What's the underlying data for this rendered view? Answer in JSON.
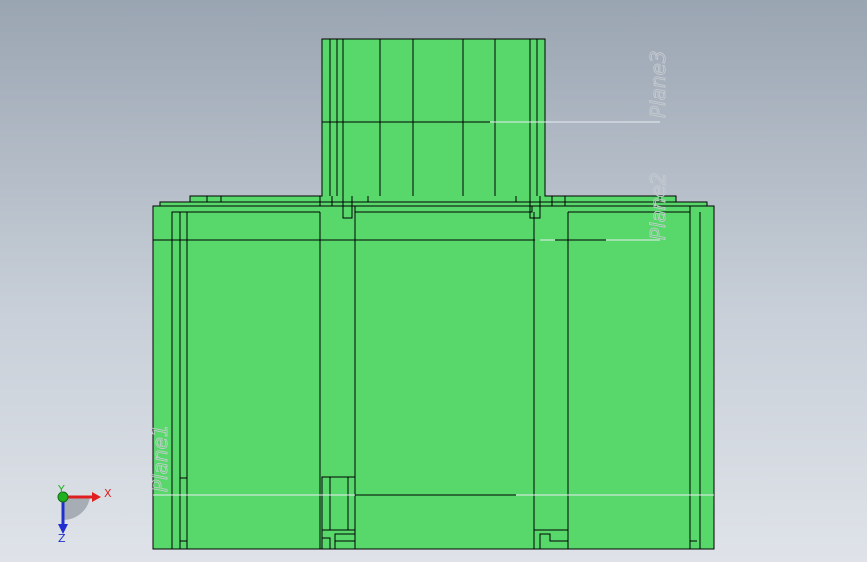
{
  "viewport": {
    "background_top": "#9aa5b2",
    "background_bottom": "#dfe3e9"
  },
  "model": {
    "face_color": "#58d86b",
    "edge_color": "#000000"
  },
  "planes": {
    "plane1_label": "Plane1",
    "plane2_label": "Plane2",
    "plane3_label": "Plane3"
  },
  "triad": {
    "x_label": "X",
    "y_label": "Y",
    "z_label": "Z",
    "x_color": "#e02020",
    "y_color": "#20b020",
    "z_color": "#2030d0"
  }
}
